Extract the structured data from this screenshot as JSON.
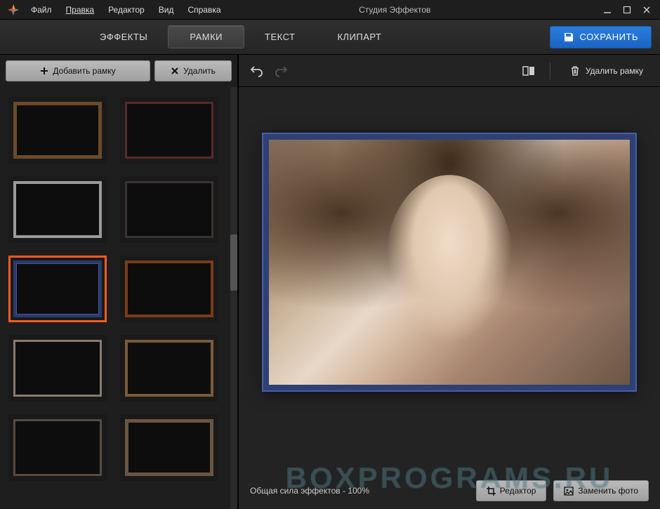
{
  "app": {
    "title": "Студия Эффектов",
    "logo_colors": [
      "#e84c3d",
      "#f1c40f",
      "#2ecc71",
      "#3498db"
    ]
  },
  "menu": {
    "file": "Файл",
    "edit": "Правка",
    "editor": "Редактор",
    "view": "Вид",
    "help": "Справка"
  },
  "tabs": {
    "effects": "ЭФФЕКТЫ",
    "frames": "РАМКИ",
    "text": "ТЕКСТ",
    "clipart": "КЛИПАРТ",
    "active": "frames"
  },
  "save": {
    "label": "СОХРАНИТЬ"
  },
  "sidebar": {
    "add_frame": "Добавить рамку",
    "delete": "Удалить",
    "frames": [
      {
        "style": "f-border-wood"
      },
      {
        "style": "f-border-red"
      },
      {
        "style": "f-border-silver"
      },
      {
        "style": "f-border-dark"
      },
      {
        "style": "f-border-blue",
        "selected": true
      },
      {
        "style": "f-border-orange"
      },
      {
        "style": "f-border-light"
      },
      {
        "style": "f-border-copper"
      },
      {
        "style": "f-border-rust"
      },
      {
        "style": "f-border-bronze"
      }
    ]
  },
  "canvas_toolbar": {
    "undo": "undo",
    "redo": "redo",
    "compare": "compare",
    "delete_frame": "Удалить рамку"
  },
  "bottom": {
    "strength_prefix": "Общая сила эффектов - ",
    "strength_value": "100%",
    "editor": "Редактор",
    "replace_photo": "Заменить фото"
  },
  "watermark": "BOXPROGRAMS.RU"
}
